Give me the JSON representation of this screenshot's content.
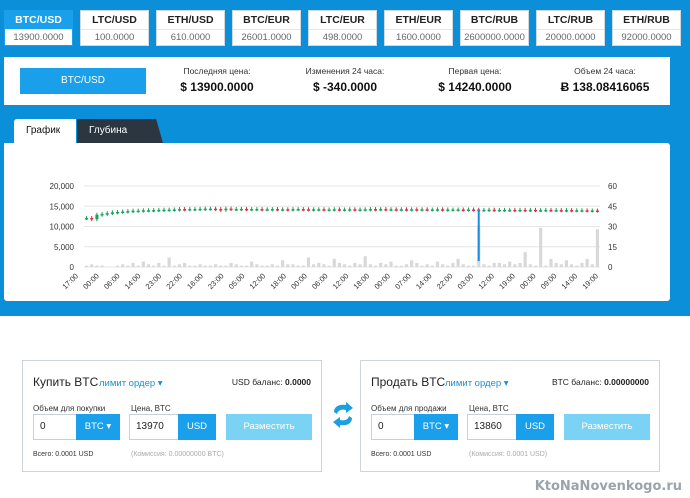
{
  "pairs": [
    {
      "name": "BTC/USD",
      "price": "13900.0000",
      "active": true
    },
    {
      "name": "LTC/USD",
      "price": "100.0000",
      "active": false
    },
    {
      "name": "ETH/USD",
      "price": "610.0000",
      "active": false
    },
    {
      "name": "BTC/EUR",
      "price": "26001.0000",
      "active": false
    },
    {
      "name": "LTC/EUR",
      "price": "498.0000",
      "active": false
    },
    {
      "name": "ETH/EUR",
      "price": "1600.0000",
      "active": false
    },
    {
      "name": "BTC/RUB",
      "price": "2600000.0000",
      "active": false
    },
    {
      "name": "LTC/RUB",
      "price": "20000.0000",
      "active": false
    },
    {
      "name": "ETH/RUB",
      "price": "92000.0000",
      "active": false
    }
  ],
  "stats": {
    "pair_button": "BTC/USD",
    "last_price_label": "Последняя цена:",
    "last_price": "$ 13900.0000",
    "change_label": "Изменения 24 часа:",
    "change": "$ -340.0000",
    "first_price_label": "Первая цена:",
    "first_price": "$ 14240.0000",
    "volume_label": "Объем 24 часа:",
    "volume": "Ƀ 138.08416065"
  },
  "chart_tabs": {
    "graph": "График",
    "depth": "Глубина рынка"
  },
  "chart_data": {
    "type": "candlestick",
    "y_left_ticks": [
      "20,000",
      "15,000",
      "10,000",
      "5,000",
      "0"
    ],
    "y_left_range": [
      0,
      20000
    ],
    "y_right_ticks": [
      "60",
      "45",
      "30",
      "15",
      "0"
    ],
    "y_right_range": [
      0,
      60
    ],
    "x_ticks": [
      "17:00",
      "00:00",
      "06:00",
      "14:00",
      "23:00",
      "22:00",
      "16:00",
      "23:00",
      "05:00",
      "12:00",
      "18:00",
      "00:00",
      "06:00",
      "12:00",
      "18:00",
      "00:00",
      "07:00",
      "14:00",
      "22:00",
      "03:00",
      "12:00",
      "19:00",
      "00:00",
      "09:00",
      "14:00",
      "19:00"
    ],
    "price": [
      12100,
      11800,
      12900,
      13100,
      13300,
      13500,
      13600,
      13700,
      13800,
      13900,
      13900,
      14000,
      14000,
      14050,
      14100,
      14150,
      14150,
      14200,
      14300,
      14250,
      14300,
      14300,
      14350,
      14400,
      14400,
      14300,
      14100,
      14400,
      14300,
      14300,
      14350,
      14300,
      14300,
      14300,
      14250,
      14250,
      14300,
      14250,
      14250,
      14200,
      14300,
      14300,
      14250,
      14200,
      14250,
      14250,
      14200,
      14200,
      14250,
      14200,
      14200,
      14250,
      14200,
      14200,
      14250,
      14300,
      14250,
      14300,
      14250,
      14250,
      14200,
      14250,
      14200,
      14250,
      14200,
      14250,
      14200,
      14200,
      14250,
      14150,
      14200,
      14200,
      14200,
      14150,
      14200,
      14150,
      14100,
      14100,
      14150,
      14100,
      14100,
      14100,
      14100,
      14050,
      14100,
      14050,
      14100,
      14050,
      14050,
      14100,
      14050,
      14050,
      14000,
      14050,
      14000,
      14000,
      14000,
      13950,
      13950,
      13900
    ],
    "volume": [
      1,
      2,
      1,
      1,
      0,
      0,
      1,
      2,
      1,
      3,
      1,
      4,
      2,
      1,
      3,
      1,
      7,
      1,
      2,
      3,
      1,
      1,
      2,
      1,
      1,
      2,
      1,
      1,
      3,
      2,
      1,
      1,
      4,
      2,
      1,
      1,
      2,
      1,
      5,
      2,
      2,
      1,
      1,
      7,
      2,
      3,
      2,
      1,
      6,
      3,
      2,
      1,
      3,
      2,
      8,
      2,
      1,
      3,
      2,
      4,
      1,
      1,
      2,
      5,
      3,
      1,
      2,
      1,
      4,
      2,
      1,
      3,
      6,
      2,
      1,
      1,
      31,
      2,
      1,
      3,
      3,
      2,
      4,
      2,
      3,
      11,
      2,
      1,
      29,
      1,
      6,
      3,
      2,
      5,
      2,
      1,
      3,
      6,
      2,
      28
    ]
  },
  "buy": {
    "title": "Купить BTC",
    "order_type": "лимит ордер",
    "balance_label": "USD баланс:",
    "balance": "0.0000",
    "amount_label": "Объем для покупки",
    "amount": "0",
    "amount_currency": "BTC",
    "price_label": "Цена, BTC",
    "price": "13970",
    "price_currency": "USD",
    "submit": "Разместить",
    "total": "Всего: 0.0001 USD",
    "commission": "(Комиссия: 0.00000000 BTC)"
  },
  "sell": {
    "title": "Продать BTC",
    "order_type": "лимит ордер",
    "balance_label": "BTC баланс:",
    "balance": "0.00000000",
    "amount_label": "Объем для продажи",
    "amount": "0",
    "amount_currency": "BTC",
    "price_label": "Цена, BTC",
    "price": "13860",
    "price_currency": "USD",
    "submit": "Разместить",
    "total": "Всего: 0.0001 USD",
    "commission": "(Комиссия: 0.0001 USD)"
  },
  "watermark": "KtoNaNovenkogo.ru"
}
